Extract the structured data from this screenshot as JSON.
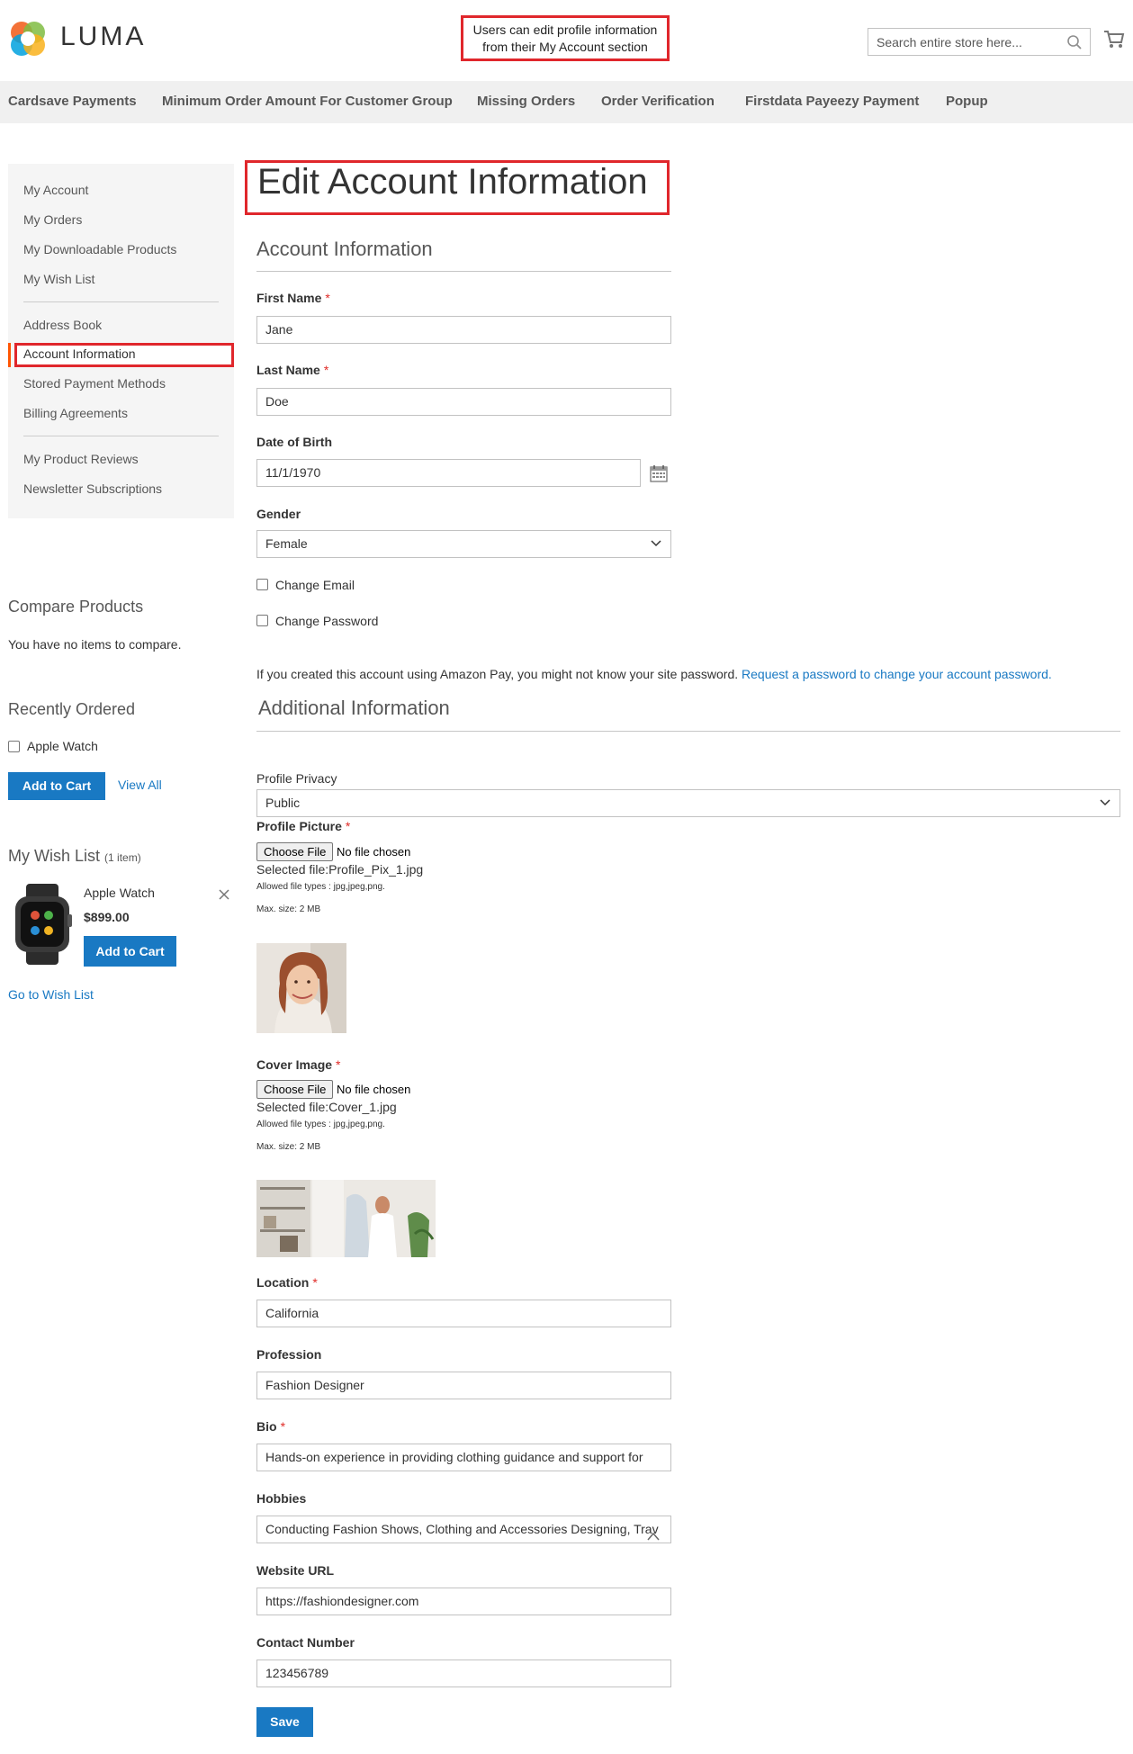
{
  "header": {
    "logo_text": "LUMA",
    "callout_line1": "Users can edit profile information",
    "callout_line2": "from their My Account section",
    "search_placeholder": "Search entire store here..."
  },
  "nav": {
    "items": [
      "Cardsave Payments",
      "Minimum Order Amount For Customer Group",
      "Missing Orders",
      "Order Verification",
      "Firstdata Payeezy Payment",
      "Popup"
    ]
  },
  "sidebar": {
    "account_nav": [
      "My Account",
      "My Orders",
      "My Downloadable Products",
      "My Wish List",
      "Address Book",
      "Account Information",
      "Stored Payment Methods",
      "Billing Agreements",
      "My Product Reviews",
      "Newsletter Subscriptions"
    ],
    "compare": {
      "title": "Compare Products",
      "empty_text": "You have no items to compare."
    },
    "recent": {
      "title": "Recently Ordered",
      "item": "Apple Watch",
      "add_to_cart": "Add to Cart",
      "view_all": "View All"
    },
    "wishlist": {
      "title": "My Wish List",
      "count": "(1 item)",
      "item_name": "Apple Watch",
      "item_price": "$899.00",
      "add_to_cart": "Add to Cart",
      "go_to": "Go to Wish List"
    }
  },
  "main": {
    "page_title": "Edit Account Information",
    "account_info": {
      "legend": "Account Information",
      "first_name_label": "First Name",
      "first_name": "Jane",
      "last_name_label": "Last Name",
      "last_name": "Doe",
      "dob_label": "Date of Birth",
      "dob": "11/1/1970",
      "gender_label": "Gender",
      "gender": "Female",
      "change_email": "Change Email",
      "change_password": "Change Password",
      "required_mark": "*"
    },
    "amazon_note": "If you created this account using Amazon Pay, you might not know your site password.",
    "amazon_link": "Request a password to change your account password.",
    "additional": {
      "legend": "Additional Information",
      "privacy_label": "Profile Privacy",
      "privacy_value": "Public",
      "picture_label": "Profile Picture",
      "choose_file": "Choose File",
      "no_file": "No file chosen",
      "picture_selected": "Selected file:Profile_Pix_1.jpg",
      "allowed_types": "Allowed file types : jpg,jpeg,png.",
      "max_size": "Max. size: 2 MB",
      "cover_label": "Cover Image",
      "cover_selected": "Selected file:Cover_1.jpg",
      "location_label": "Location",
      "location": "California",
      "profession_label": "Profession",
      "profession": "Fashion Designer",
      "bio_label": "Bio",
      "bio": "Hands-on experience in providing clothing guidance and support for",
      "hobbies_label": "Hobbies",
      "hobbies": "Conducting Fashion Shows, Clothing and Accessories Designing, Trav",
      "website_label": "Website URL",
      "website": "https://fashiondesigner.com",
      "contact_label": "Contact Number",
      "contact": "123456789",
      "save": "Save"
    }
  },
  "colors": {
    "accent_blue": "#1979c3",
    "highlight_red": "#e0272c",
    "nav_bg": "#f0f0f0",
    "sidebar_bg": "#f5f5f5",
    "active_bar": "#ff5501"
  }
}
